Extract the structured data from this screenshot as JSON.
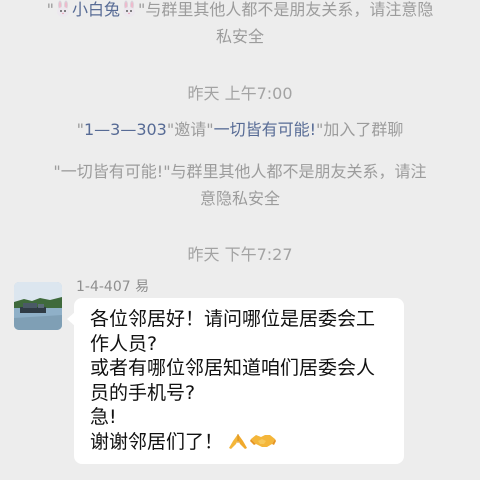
{
  "messages": {
    "notice1": {
      "quote_open": "\"",
      "name": "小白兔",
      "quote_close": "\"",
      "line1_rest": "与群里其他人都不是朋友关系，请注意隐",
      "line2": "私安全"
    },
    "time1": "昨天 上午7:00",
    "invite": {
      "quote1": "\"",
      "inviter": "1—3—303",
      "quote2": "\"",
      "verb": "邀请",
      "quote3": "\"",
      "invitee": "一切皆有可能!",
      "quote4": "\"",
      "suffix": "加入了群聊"
    },
    "notice2": {
      "line1": "\"一切皆有可能!\"与群里其他人都不是朋友关系，请注",
      "line2": "意隐私安全"
    },
    "time2": "昨天 下午7:27",
    "chat": {
      "sender": "1-4-407 易",
      "lines": [
        "各位邻居好！请问哪位是居委会工",
        "作人员?",
        "或者有哪位邻居知道咱们居委会人",
        "员的手机号?",
        "急!",
        "谢谢邻居们了！"
      ],
      "emoji_names": [
        "folded-hands-icon",
        "handshake-icon"
      ]
    }
  },
  "colors": {
    "background": "#ededed",
    "system_text": "#9c9c9c",
    "link_blue": "#576b95",
    "bubble": "#ffffff"
  }
}
